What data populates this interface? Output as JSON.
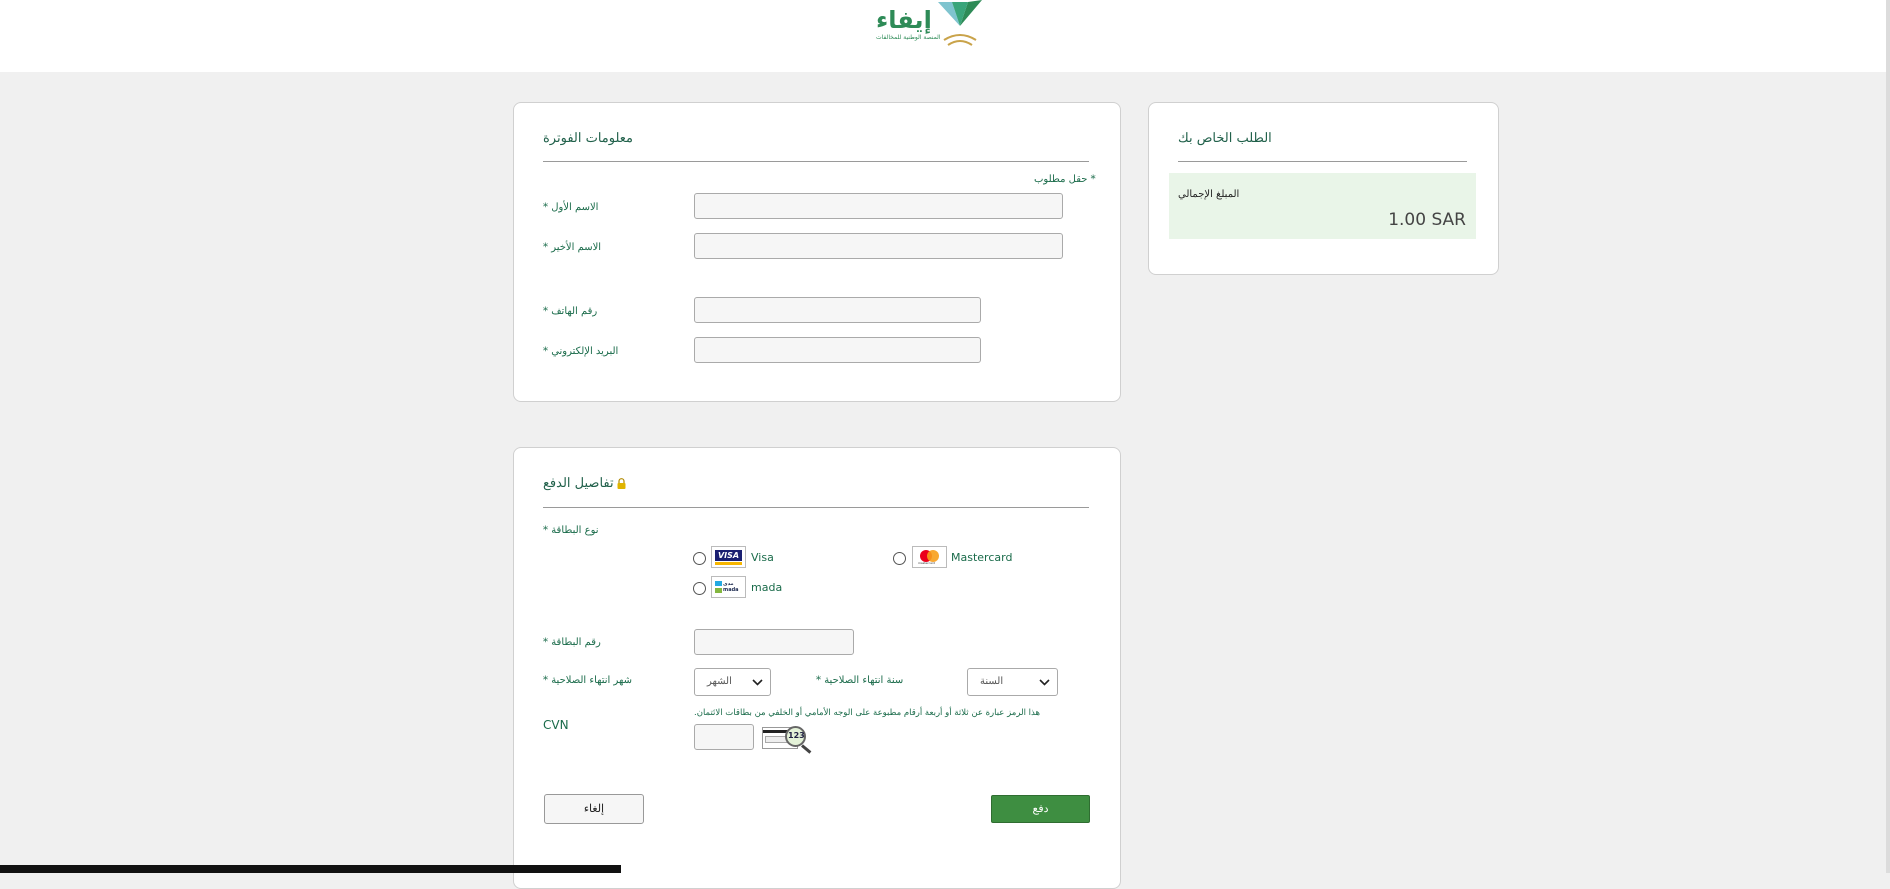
{
  "header": {
    "logo_text": "إيفاء",
    "logo_subtitle": "المنصة الوطنية للمخالفات"
  },
  "billing": {
    "title": "معلومات الفوترة",
    "required_note": "حقل مطلوب *",
    "first_name_label": "* الاسم الأول",
    "last_name_label": "* الاسم الأخير",
    "phone_label": "* رقم الهاتف",
    "email_label": "* البريد الإلكتروني",
    "first_name_value": "",
    "last_name_value": "",
    "phone_value": "",
    "email_value": ""
  },
  "order": {
    "title": "الطلب الخاص بك",
    "total_label": "المبلغ الإجمالي",
    "total_value": "1.00 SAR"
  },
  "payment": {
    "title": "تفاصيل الدفع",
    "card_type_label": "* نوع البطاقة",
    "card_types": [
      {
        "name": "Visa",
        "logo_text": "VISA"
      },
      {
        "name": "Mastercard",
        "logo_text": "mastercard"
      },
      {
        "name": "mada",
        "logo_text": "مدى mada"
      }
    ],
    "card_number_label": "* رقم البطاقة",
    "card_number_value": "",
    "expiry_month_label": "* شهر انتهاء الصلاحية",
    "expiry_month_value": "الشهر",
    "expiry_year_label": "* سنة انتهاء الصلاحية",
    "expiry_year_value": "السنة",
    "cvn_label": "CVN",
    "cvn_help": ".هذا الرمز عبارة عن ثلاثة أو أربعة أرقام مطبوعة على الوجه الأمامي أو الخلفي من بطاقات الائتمان",
    "cvn_value": "",
    "cvn_image_text": "123",
    "pay_button": "دفع",
    "cancel_button": "إلغاء"
  },
  "colors": {
    "brand_green": "#2e8b57",
    "label_green": "#1a6b4a",
    "pay_button": "#3e8e41",
    "summary_bg": "#e9f5e8",
    "lock_gold": "#e0b400"
  },
  "icons": [
    "logo-mark-icon",
    "lock-icon",
    "chevron-down-icon",
    "cvn-card-icon",
    "magnifier-icon"
  ]
}
